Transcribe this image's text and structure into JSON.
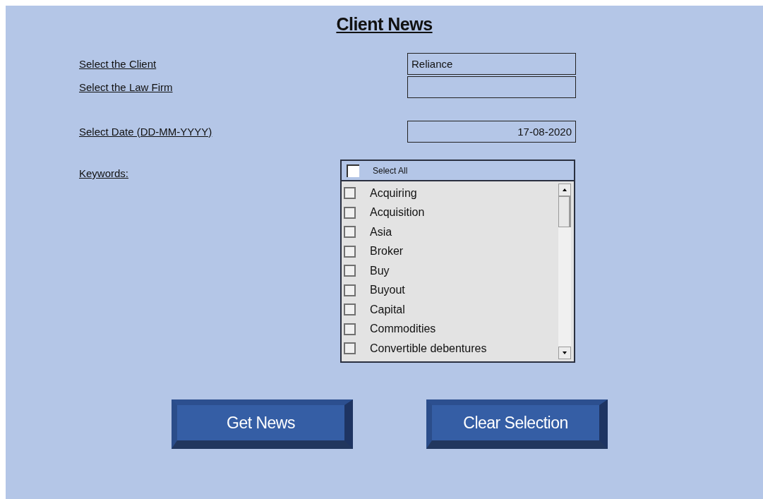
{
  "title": "Client News",
  "fields": [
    {
      "label": "Select the Client",
      "value": "Reliance",
      "kind": "text"
    },
    {
      "label": "Select the Law Firm",
      "kind": "text"
    },
    {
      "label": "Select Date (DD-MM-YYYY)",
      "value": "17-08-2020",
      "kind": "date"
    }
  ],
  "keywords": {
    "label": "Keywords:",
    "select_all": {
      "label": "Select All",
      "checked": false
    },
    "items": [
      {
        "label": "Acquiring",
        "checked": false
      },
      {
        "label": "Acquisition",
        "checked": false
      },
      {
        "label": "Asia",
        "checked": false
      },
      {
        "label": "Broker",
        "checked": false
      },
      {
        "label": "Buy",
        "checked": false
      },
      {
        "label": "Buyout",
        "checked": false
      },
      {
        "label": "Capital",
        "checked": false
      },
      {
        "label": "Commodities",
        "checked": false
      },
      {
        "label": "Convertible debentures",
        "checked": false
      }
    ]
  },
  "buttons": [
    "Get News",
    "Clear Selection"
  ]
}
